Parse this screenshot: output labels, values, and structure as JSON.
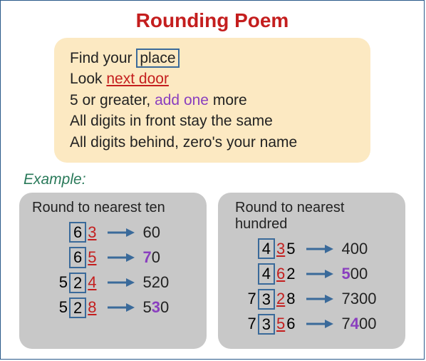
{
  "title": "Rounding Poem",
  "poem": {
    "l1a": "Find your ",
    "l1_place": "place",
    "l2a": "Look ",
    "l2_next": "next door",
    "l3a": "5 or greater, ",
    "l3_add": "add one",
    "l3b": " more",
    "l4": "All digits in front stay the same",
    "l5": "All digits behind, zero's your name"
  },
  "example_label": "Example:",
  "left": {
    "title": "Round to nearest ten",
    "rows": [
      {
        "pre": "",
        "box": "6",
        "under": "3",
        "post": "",
        "res_a": "60",
        "res_p": "",
        "res_b": ""
      },
      {
        "pre": "",
        "box": "6",
        "under": "5",
        "post": "",
        "res_a": "",
        "res_p": "7",
        "res_b": "0"
      },
      {
        "pre": "5",
        "box": "2",
        "under": "4",
        "post": "",
        "res_a": "520",
        "res_p": "",
        "res_b": ""
      },
      {
        "pre": "5",
        "box": "2",
        "under": "8",
        "post": "",
        "res_a": "5",
        "res_p": "3",
        "res_b": "0"
      }
    ]
  },
  "right": {
    "title": "Round to nearest hundred",
    "rows": [
      {
        "pre": "",
        "box": "4",
        "under": "3",
        "post": "5",
        "res_a": "400",
        "res_p": "",
        "res_b": ""
      },
      {
        "pre": "",
        "box": "4",
        "under": "6",
        "post": "2",
        "res_a": "",
        "res_p": "5",
        "res_b": "00"
      },
      {
        "pre": "7",
        "box": "3",
        "under": "2",
        "post": "8",
        "res_a": "7300",
        "res_p": "",
        "res_b": ""
      },
      {
        "pre": "7",
        "box": "3",
        "under": "5",
        "post": "6",
        "res_a": "7",
        "res_p": "4",
        "res_b": "00"
      }
    ]
  }
}
